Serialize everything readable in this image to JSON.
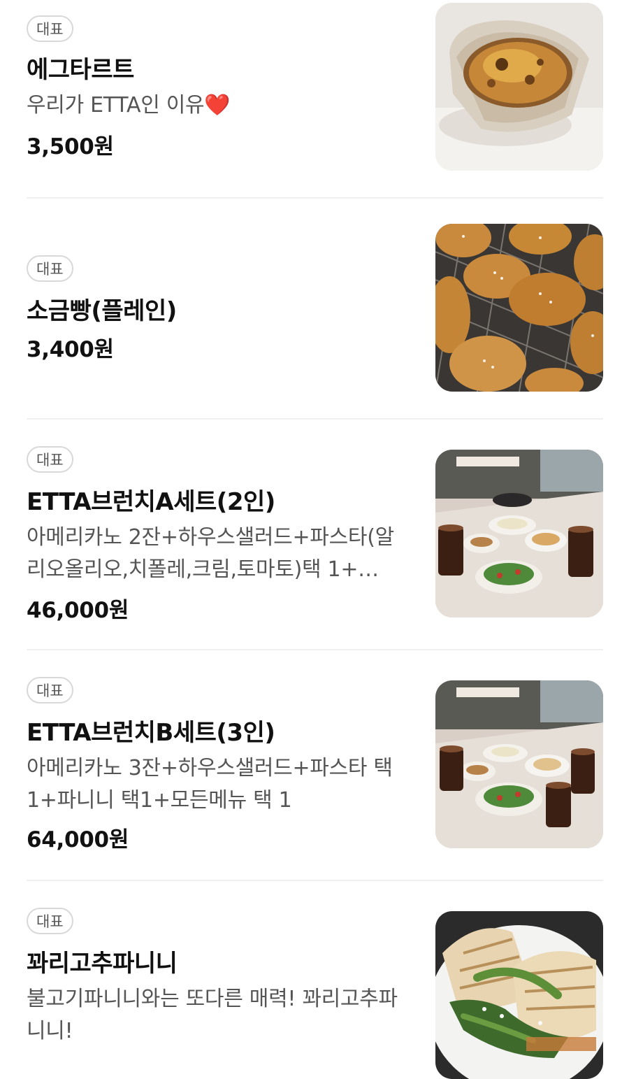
{
  "badge_label": "대표",
  "items": [
    {
      "name": "에그타르트",
      "description_text": "우리가 ETTA인 이유",
      "description_emoji": "❤️",
      "price": "3,500원",
      "image_icon": "egg-tart-photo"
    },
    {
      "name": "소금빵(플레인)",
      "price": "3,400원",
      "image_icon": "salt-bread-photo"
    },
    {
      "name": "ETTA브런치A세트(2인)",
      "description": "아메리카노 2잔+하우스샐러드+파스타(알리오올리오,치폴레,크림,토마토)택 1+…",
      "price": "46,000원",
      "image_icon": "brunch-set-photo"
    },
    {
      "name": "ETTA브런치B세트(3인)",
      "description": "아메리카노 3잔+하우스샐러드+파스타 택1+파니니 택1+모든메뉴 택 1",
      "price": "64,000원",
      "image_icon": "brunch-set-photo"
    },
    {
      "name": "꽈리고추파니니",
      "description": "불고기파니니와는 또다른 매력! 꽈리고추파니니!",
      "image_icon": "panini-photo"
    }
  ]
}
